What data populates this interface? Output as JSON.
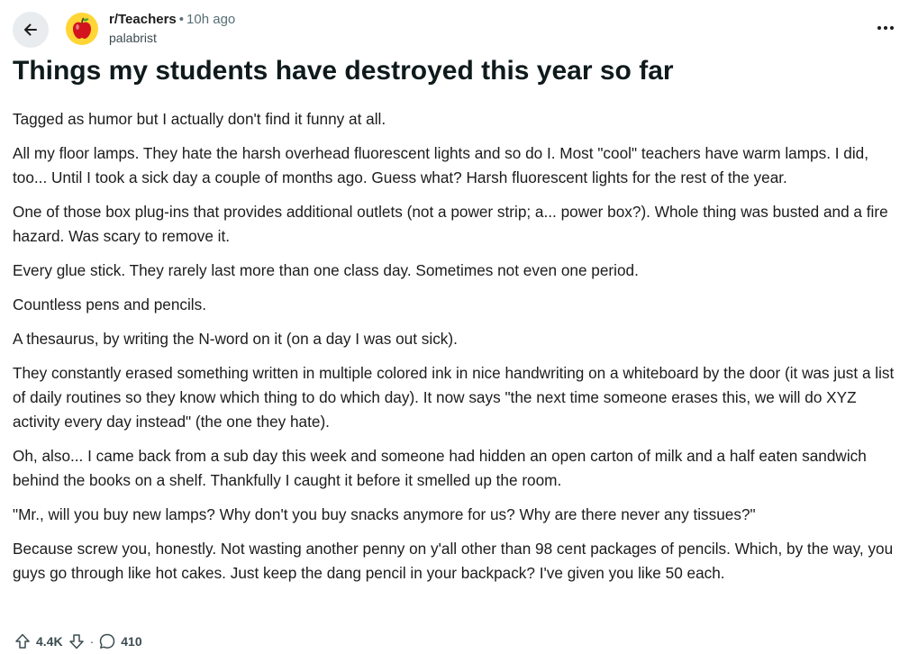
{
  "header": {
    "subreddit": "r/Teachers",
    "separator": "•",
    "time": "10h ago",
    "author": "palabrist"
  },
  "post": {
    "title": "Things my students have destroyed this year so far",
    "paragraphs": [
      "Tagged as humor but I actually don't find it funny at all.",
      "All my floor lamps. They hate the harsh overhead fluorescent lights and so do I. Most \"cool\" teachers have warm lamps. I did, too... Until I took a sick day a couple of months ago. Guess what? Harsh fluorescent lights for the rest of the year.",
      "One of those box plug-ins that provides additional outlets (not a power strip; a... power box?). Whole thing was busted and a fire hazard. Was scary to remove it.",
      "Every glue stick. They rarely last more than one class day. Sometimes not even one period.",
      "Countless pens and pencils.",
      "A thesaurus, by writing the N-word on it (on a day I was out sick).",
      "They constantly erased something written in multiple colored ink in nice handwriting on a whiteboard by the door (it was just a list of daily routines so they know which thing to do which day). It now says \"the next time someone erases this, we will do XYZ activity every day instead\" (the one they hate).",
      "Oh, also... I came back from a sub day this week and someone had hidden an open carton of milk and a half eaten sandwich behind the books on a shelf. Thankfully I caught it before it smelled up the room.",
      "\"Mr., will you buy new lamps? Why don't you buy snacks anymore for us? Why are there never any tissues?\"",
      "Because screw you, honestly. Not wasting another penny on y'all other than 98 cent packages of pencils. Which, by the way, you guys go through like hot cakes. Just keep the dang pencil in your backpack? I've given you like 50 each."
    ]
  },
  "actions": {
    "upvotes": "4.4K",
    "separator": "·",
    "comments": "410"
  },
  "icons": {
    "back": "arrow-left-icon",
    "avatar": "apple-icon",
    "more": "more-horizontal-icon",
    "upvote": "upvote-arrow-icon",
    "downvote": "downvote-arrow-icon",
    "comment": "comment-bubble-icon"
  },
  "colors": {
    "avatar_bg": "#ffd635",
    "apple_red": "#d3141e",
    "back_bg": "#e9ecef",
    "meta_gray": "#576f76"
  }
}
